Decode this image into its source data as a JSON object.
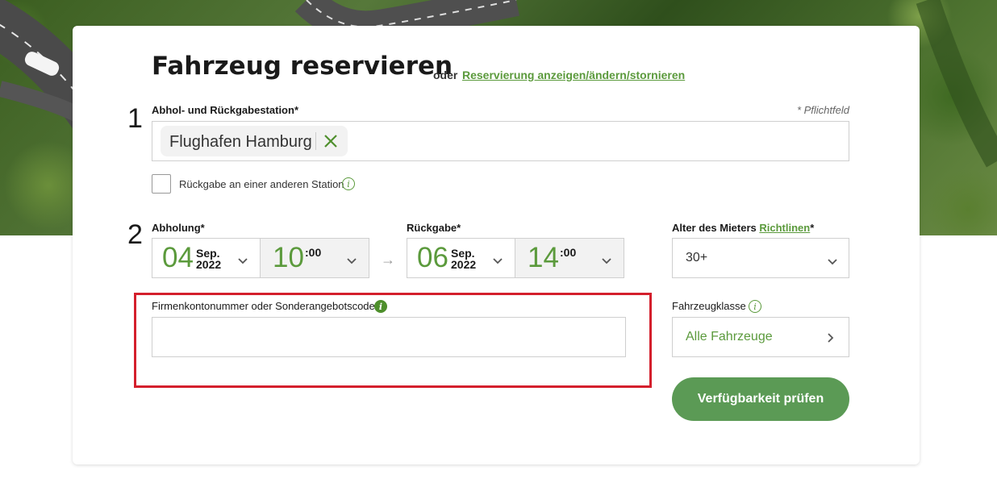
{
  "header": {
    "title": "Fahrzeug reservieren",
    "oder": "oder",
    "manage_link": "Reservierung anzeigen/ändern/stornieren"
  },
  "step1": {
    "number": "1",
    "label": "Abhol- und Rückgabestation*",
    "required_note": "* Pflichtfeld",
    "station_value": "Flughafen Hamburg",
    "clear_icon": "close-icon",
    "return_other_label": "Rückgabe an einer anderen Station",
    "return_other_checked": false
  },
  "step2": {
    "number": "2",
    "pickup": {
      "label": "Abholung*",
      "day": "04",
      "month": "Sep.",
      "year": "2022",
      "hour": "10",
      "minute": ":00"
    },
    "return": {
      "label": "Rückgabe*",
      "day": "06",
      "month": "Sep.",
      "year": "2022",
      "hour": "14",
      "minute": ":00"
    },
    "arrow": "→",
    "age": {
      "label": "Alter des Mieters",
      "link": "Richtlinen",
      "required": "*",
      "value": "30+"
    }
  },
  "promo": {
    "label": "Firmenkontonummer oder Sonderangebotscode",
    "value": "",
    "info_icon": "info-icon"
  },
  "vehicle_class": {
    "label": "Fahrzeugklasse",
    "value": "Alle Fahrzeuge"
  },
  "submit": {
    "label": "Verfügbarkeit prüfen"
  },
  "colors": {
    "accent": "#5b9a3c",
    "button": "#5b9a55",
    "highlight": "#d41f2c"
  }
}
